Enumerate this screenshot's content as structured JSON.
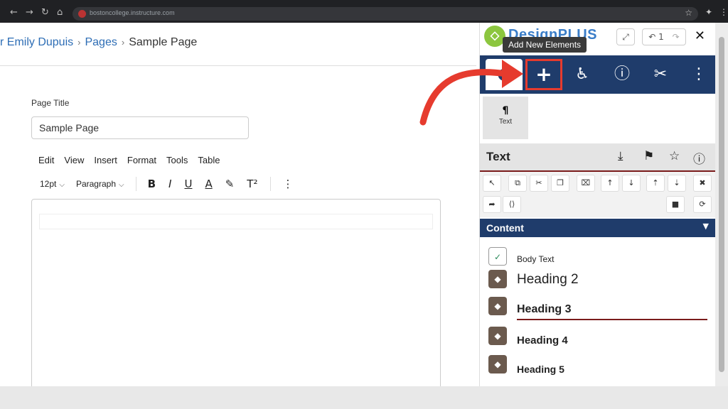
{
  "browser": {
    "url": "bostoncollege.instructure.com",
    "back": "←",
    "forward": "→",
    "reload": "↻",
    "home": "⌂",
    "star": "☆",
    "extensions": "✦",
    "menu": "⋮"
  },
  "breadcrumb": {
    "items": [
      "r Emily Dupuis",
      "Pages"
    ],
    "current": "Sample Page",
    "separator": "›"
  },
  "editor": {
    "page_title_label": "Page Title",
    "page_title_value": "Sample Page",
    "menu": [
      "Edit",
      "View",
      "Insert",
      "Format",
      "Tools",
      "Table"
    ],
    "font_size": "12pt",
    "block_format": "Paragraph",
    "bold": "B",
    "italic": "I",
    "underline": "U",
    "text_color": "A",
    "highlight": "✎",
    "superscript": "T²",
    "more": "⋮",
    "caret": "⌵"
  },
  "panel": {
    "logo_text": "DesignPLUS",
    "undo_count": "1",
    "tooltip": "Add New Elements",
    "tabs": {
      "add": "+",
      "accessibility": "♿",
      "help": "?",
      "tools": "✂",
      "more": "⋮"
    },
    "element_tile": {
      "icon": "¶",
      "label": "Text"
    },
    "section_title": "Text",
    "content_title": "Content",
    "content_items": [
      {
        "label": "Body Text"
      },
      {
        "label": "Heading 2"
      },
      {
        "label": "Heading 3"
      },
      {
        "label": "Heading 4"
      },
      {
        "label": "Heading 5"
      }
    ]
  },
  "colors": {
    "brand_navy": "#1f3c6b",
    "highlight_red": "#e63b2e",
    "link_blue": "#2d6db5",
    "accent_maroon": "#7a1b1b",
    "logo_green": "#8cc63f"
  },
  "icons": [
    "expand-icon",
    "undo-icon",
    "redo-icon",
    "close-icon",
    "plus-icon",
    "accessibility-icon",
    "help-icon",
    "tools-icon",
    "more-vertical-icon",
    "download-icon",
    "footprints-icon",
    "star-icon",
    "info-icon",
    "cursor-icon",
    "copy-icon",
    "cut-icon",
    "duplicate-icon",
    "clear-format-icon",
    "move-up-icon",
    "move-down-icon",
    "insert-before-icon",
    "insert-after-icon",
    "trash-icon",
    "redo-arrow-icon",
    "code-icon",
    "lock-icon",
    "refresh-icon",
    "checkmark-icon",
    "drag-handle-icon"
  ]
}
